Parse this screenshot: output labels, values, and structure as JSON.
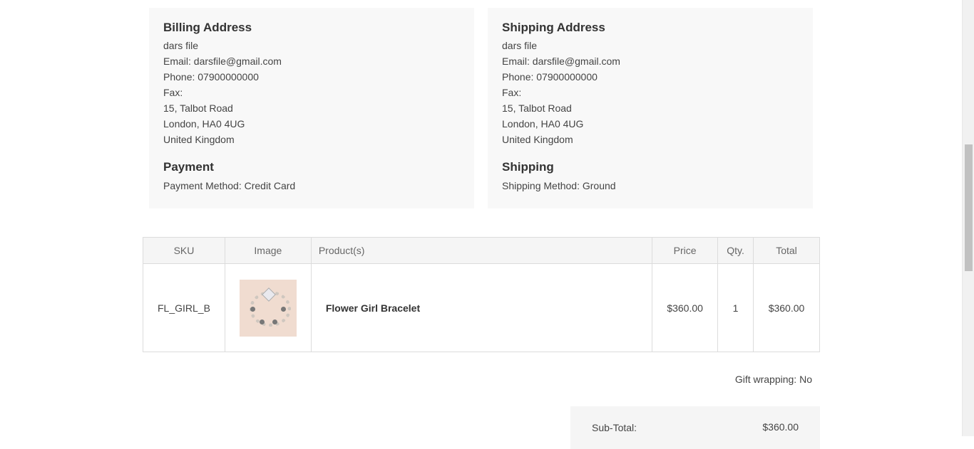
{
  "billing": {
    "title": "Billing Address",
    "name": "dars file",
    "email": "Email: darsfile@gmail.com",
    "phone": "Phone: 07900000000",
    "fax": "Fax:",
    "street": "15, Talbot Road",
    "city": "London, HA0 4UG",
    "country": "United Kingdom"
  },
  "payment": {
    "title": "Payment",
    "method": "Payment Method: Credit Card"
  },
  "shipping_address": {
    "title": "Shipping Address",
    "name": "dars file",
    "email": "Email: darsfile@gmail.com",
    "phone": "Phone: 07900000000",
    "fax": "Fax:",
    "street": "15, Talbot Road",
    "city": "London, HA0 4UG",
    "country": "United Kingdom"
  },
  "shipping": {
    "title": "Shipping",
    "method": "Shipping Method: Ground"
  },
  "table": {
    "headers": {
      "sku": "SKU",
      "image": "Image",
      "product": "Product(s)",
      "price": "Price",
      "qty": "Qty.",
      "total": "Total"
    },
    "rows": [
      {
        "sku": "FL_GIRL_B",
        "image_icon": "bracelet-product-image",
        "product": "Flower Girl Bracelet",
        "price": "$360.00",
        "qty": "1",
        "total": "$360.00"
      }
    ]
  },
  "gift_wrapping": "Gift wrapping: No",
  "totals": {
    "subtotal_label": "Sub-Total:",
    "subtotal_value": "$360.00"
  },
  "colors": {
    "panel_bg": "#f8f8f8",
    "table_header_bg": "#f5f5f5",
    "border": "#dcdcdc"
  }
}
